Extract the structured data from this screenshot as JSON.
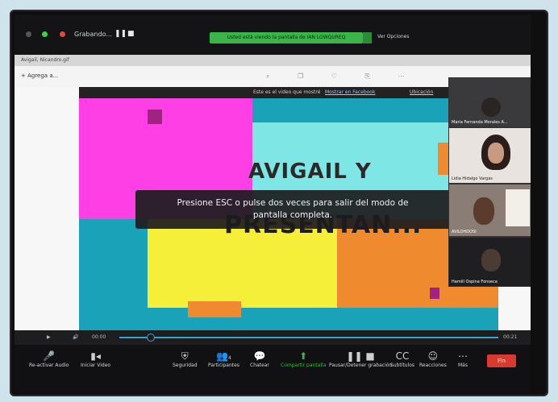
{
  "recording": {
    "label": "Grabando..."
  },
  "topbar": {
    "share_banner": "Usted está viendo la pantalla de IAN LOWQUREQ",
    "view_options": "Ver Opciones"
  },
  "browser": {
    "tab_title": "Avigail, Nicandro.gif",
    "add_label": "Agrega a..."
  },
  "fullscreen_bar": {
    "text": "Este es el video que mostré",
    "link1": "Mostrar en Facebook",
    "link2": "Ubicación"
  },
  "slide": {
    "title_line1": "AVIGAIL Y",
    "title_line2": "PRESENTAN..."
  },
  "toast": {
    "line1": "Presione ESC o pulse dos veces para salir del modo de",
    "line2": "pantalla completa."
  },
  "participants": [
    {
      "name": "Maria Fernanda Morales A..."
    },
    {
      "name": "Lidia Hidalgo Vargas"
    },
    {
      "name": "AVILOHDOSI"
    },
    {
      "name": "Hamill Ospina Fonseca"
    }
  ],
  "media": {
    "time_current": "00:00",
    "time_total": "00:21"
  },
  "toolbar": {
    "unmute": "Re-activar Audio",
    "video": "Iniciar Video",
    "security": "Seguridad",
    "participants": "Participantes",
    "participants_count": "4",
    "chat": "Chatear",
    "share": "Compartir pantalla",
    "pause_share": "Pausar/Detener grabación",
    "subtitles": "Subtítulos",
    "reactions": "Reacciones",
    "more": "Más",
    "end": "Fin"
  },
  "colors": {
    "magenta": "#ff3fe6",
    "teal": "#19a2b8",
    "cyan": "#7fe6e6",
    "yellow": "#f5ef3a",
    "orange": "#f08a2e",
    "zoom_green": "#3bb54a",
    "end_red": "#d83a2f"
  }
}
